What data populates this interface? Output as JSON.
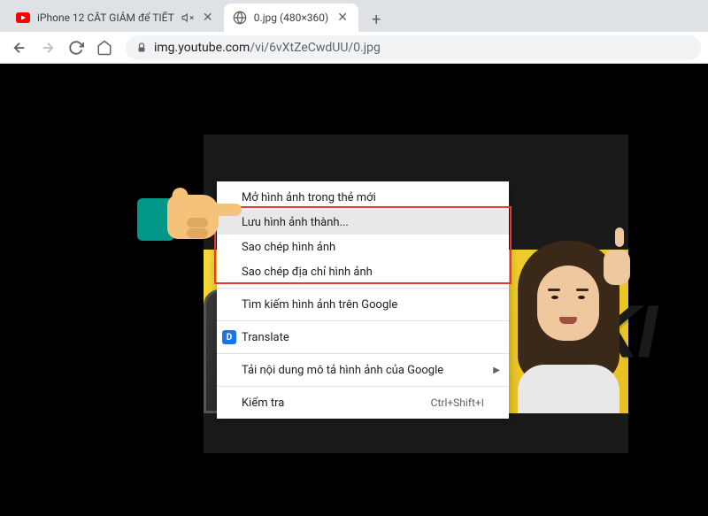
{
  "tabs": [
    {
      "title": "iPhone 12 CẮT GIẢM để TIẾT",
      "muted": true
    },
    {
      "title": "0.jpg (480×360)",
      "muted": false
    }
  ],
  "toolbar": {
    "url_domain": "img.youtube.com",
    "url_path": "/vi/6vXtZeCwdUU/0.jpg"
  },
  "thumbnail": {
    "big_text": "T KI"
  },
  "context_menu": {
    "items": [
      {
        "label": "Mở hình ảnh trong thẻ mới"
      },
      {
        "label": "Lưu hình ảnh thành...",
        "hovered": true
      },
      {
        "label": "Sao chép hình ảnh"
      },
      {
        "label": "Sao chép địa chỉ hình ảnh"
      }
    ],
    "search_label": "Tìm kiếm hình ảnh trên Google",
    "translate_label": "Translate",
    "describe_label": "Tải nội dung mô tả hình ảnh của Google",
    "inspect_label": "Kiểm tra",
    "inspect_shortcut": "Ctrl+Shift+I"
  }
}
